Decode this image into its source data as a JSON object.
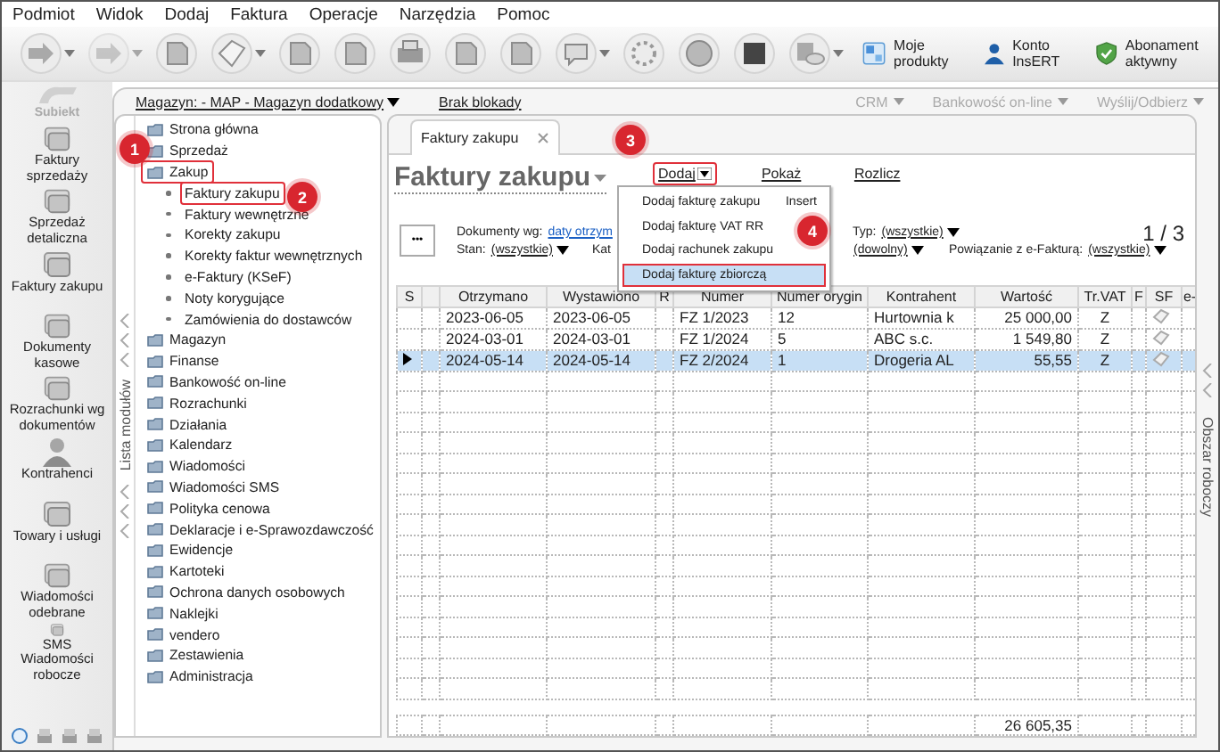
{
  "menu_bar": [
    "Podmiot",
    "Widok",
    "Dodaj",
    "Faktura",
    "Operacje",
    "Narzędzia",
    "Pomoc"
  ],
  "toolbar": {
    "items": [
      {
        "label": "Moje produkty"
      },
      {
        "label": "Konto InsERT"
      },
      {
        "label": "Abonament aktywny"
      }
    ]
  },
  "top_bar": {
    "warehouse": "Magazyn: - MAP - Magazyn dodatkowy",
    "lock_status": "Brak blokady",
    "buttons": [
      {
        "label": "CRM",
        "disabled": true
      },
      {
        "label": "Bankowość on-line",
        "disabled": true
      },
      {
        "label": "Wyślij/Odbierz",
        "disabled": true
      }
    ]
  },
  "left_nav": {
    "logo": "Subiekt",
    "items": [
      {
        "label": "Faktury sprzedaży"
      },
      {
        "label": "Sprzedaż detaliczna"
      },
      {
        "label": "Faktury zakupu"
      },
      {
        "label": "Dokumenty kasowe"
      },
      {
        "label": "Rozrachunki wg dokumentów"
      },
      {
        "label": "Kontrahenci"
      },
      {
        "label": "Towary i usługi"
      },
      {
        "label": "Wiadomości odebrane"
      },
      {
        "label": "SMS Wiadomości robocze"
      }
    ]
  },
  "module_list": {
    "side_label": "Lista modułów",
    "items": [
      {
        "label": "Strona główna",
        "highlighted": false
      },
      {
        "label": "Sprzedaż",
        "highlighted": false
      },
      {
        "label": "Zakup",
        "highlighted": true,
        "expanded": true,
        "children": [
          {
            "label": "Faktury zakupu",
            "highlighted": true
          },
          {
            "label": "Faktury wewnętrzne",
            "highlighted": false
          },
          {
            "label": "Korekty zakupu",
            "highlighted": false
          },
          {
            "label": "Korekty faktur wewnętrznych",
            "highlighted": false
          },
          {
            "label": "e-Faktury (KSeF)",
            "highlighted": false
          },
          {
            "label": "Noty korygujące",
            "highlighted": false
          },
          {
            "label": "Zamówienia do dostawców",
            "highlighted": false
          }
        ]
      },
      {
        "label": "Magazyn",
        "highlighted": false
      },
      {
        "label": "Finanse",
        "highlighted": false
      },
      {
        "label": "Bankowość on-line",
        "highlighted": false
      },
      {
        "label": "Rozrachunki",
        "highlighted": false
      },
      {
        "label": "Działania",
        "highlighted": false
      },
      {
        "label": "Kalendarz",
        "highlighted": false
      },
      {
        "label": "Wiadomości",
        "highlighted": false
      },
      {
        "label": "Wiadomości SMS",
        "highlighted": false
      },
      {
        "label": "Polityka cenowa",
        "highlighted": false
      },
      {
        "label": "Deklaracje i e-Sprawozdawczość",
        "highlighted": false
      },
      {
        "label": "Ewidencje",
        "highlighted": false
      },
      {
        "label": "Kartoteki",
        "highlighted": false
      },
      {
        "label": "Ochrona danych osobowych",
        "highlighted": false
      },
      {
        "label": "Naklejki",
        "highlighted": false
      },
      {
        "label": "vendero",
        "highlighted": false
      },
      {
        "label": "Zestawienia",
        "highlighted": false
      },
      {
        "label": "Administracja",
        "highlighted": false
      }
    ]
  },
  "workspace_label": "Obszar roboczy",
  "tab": {
    "label": "Faktury zakupu",
    "selected": true
  },
  "title": "Faktury zakupu",
  "actions": [
    {
      "label": "Dodaj",
      "dropdown": true,
      "highlighted": true
    },
    {
      "label": "Pokaż",
      "dropdown": false,
      "highlighted": false
    },
    {
      "label": "Rozlicz",
      "dropdown": false,
      "highlighted": false
    }
  ],
  "dropdown_menu": {
    "items": [
      {
        "label": "Dodaj fakturę zakupu",
        "shortcut": "Insert",
        "selected": false,
        "highlighted": false
      },
      {
        "label": "Dodaj fakturę VAT RR",
        "selected": false,
        "highlighted": false
      },
      {
        "label": "Dodaj rachunek zakupu",
        "selected": false,
        "highlighted": false
      },
      {
        "label": "Dodaj fakturę zbiorczą",
        "selected": true,
        "highlighted": true
      }
    ]
  },
  "more_button": "•••",
  "filters": {
    "documents_by": {
      "label": "Dokumenty wg:",
      "value": "daty otrzym"
    },
    "type": {
      "label": "Typ:",
      "value": "(wszystkie)"
    },
    "status": {
      "label": "Stan:",
      "value": "(wszystkie)"
    },
    "category": {
      "label": "Kat",
      "value": "(dowolny)"
    },
    "e_invoice_link": {
      "label": "Powiązanie z e-Fakturą:",
      "value": "(wszystkie)"
    }
  },
  "pager": "1 / 3",
  "table": {
    "columns": [
      "S",
      "Otrzymano",
      "Wystawiono",
      "R",
      "Numer",
      "Numer orygin",
      "Kontrahent",
      "Wartość",
      "Tr.VAT",
      "F",
      "SF",
      "e-"
    ],
    "rows": [
      {
        "received": "2023-06-05",
        "issued": "2023-06-05",
        "number": "FZ 1/2023",
        "original_number": "12",
        "contractor": "Hurtownia k",
        "value": "25 000,00",
        "vat": "Z",
        "selected": false
      },
      {
        "received": "2024-03-01",
        "issued": "2024-03-01",
        "number": "FZ 1/2024",
        "original_number": "5",
        "contractor": "ABC s.c.",
        "value": "1 549,80",
        "vat": "Z",
        "selected": false
      },
      {
        "received": "2024-05-14",
        "issued": "2024-05-14",
        "number": "FZ 2/2024",
        "original_number": "1",
        "contractor": "Drogeria AL",
        "value": "55,55",
        "vat": "Z",
        "selected": true
      }
    ],
    "total": "26 605,35"
  },
  "annotations": [
    {
      "number": "1"
    },
    {
      "number": "2"
    },
    {
      "number": "3"
    },
    {
      "number": "4"
    }
  ]
}
